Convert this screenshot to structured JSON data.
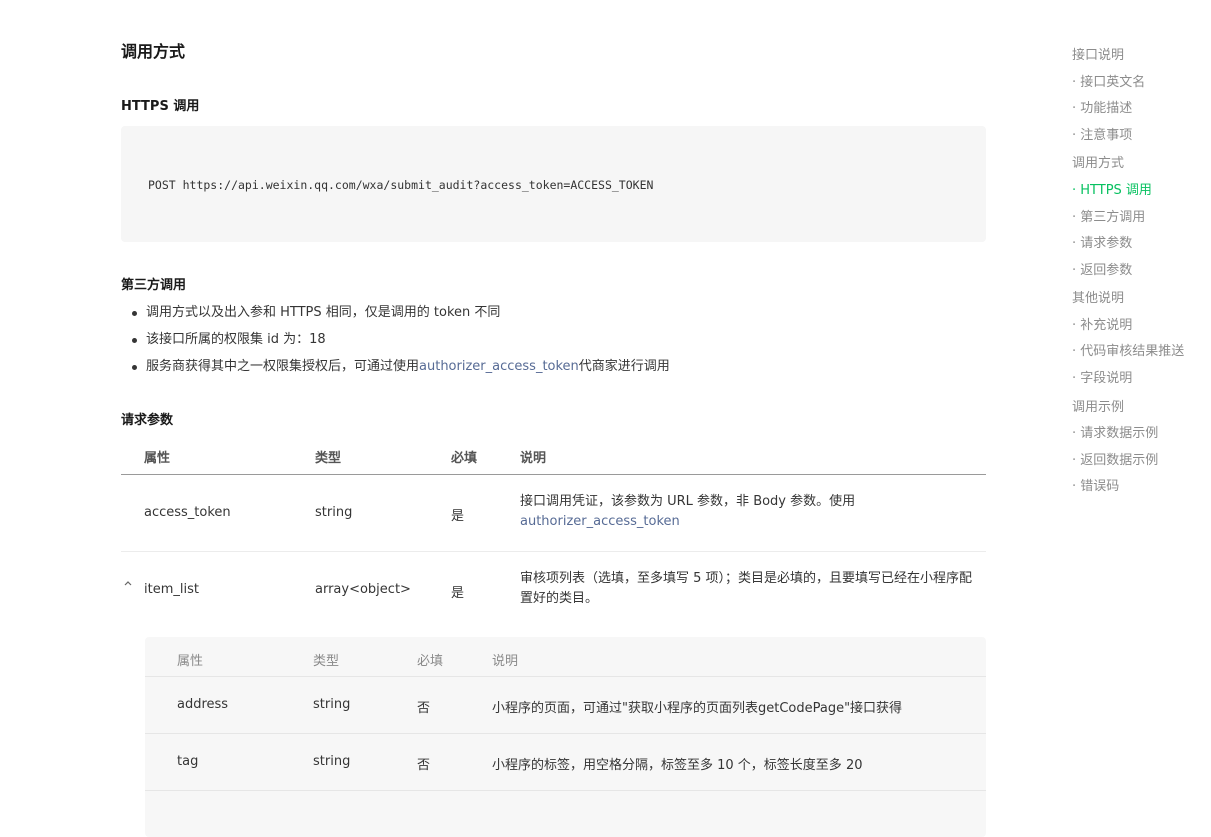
{
  "sections": {
    "call_method": "调用方式",
    "https_call": "HTTPS 调用",
    "code_line": "POST https://api.weixin.qq.com/wxa/submit_audit?access_token=ACCESS_TOKEN",
    "third_party": "第三方调用",
    "bullets": [
      "调用方式以及出入参和 HTTPS 相同，仅是调用的 token 不同",
      "该接口所属的权限集 id 为：18"
    ],
    "bullet3_prefix": "服务商获得其中之一权限集授权后，可通过使用",
    "bullet3_link": "authorizer_access_token",
    "bullet3_suffix": "代商家进行调用",
    "request_params": "请求参数"
  },
  "table": {
    "headers": [
      "属性",
      "类型",
      "必填",
      "说明"
    ],
    "rows": [
      {
        "name": "access_token",
        "type": "string",
        "required": "是",
        "desc": "接口调用凭证，该参数为 URL 参数，非 Body 参数。使用",
        "desc_link": "authorizer_access_token"
      },
      {
        "name": "item_list",
        "type": "array<object>",
        "required": "是",
        "desc": "审核项列表（选填，至多填写 5 项）；类目是必填的，且要填写已经在小程序配置好的类目。"
      }
    ]
  },
  "subtable": {
    "headers": [
      "属性",
      "类型",
      "必填",
      "说明"
    ],
    "rows": [
      {
        "name": "address",
        "type": "string",
        "required": "否",
        "desc": "小程序的页面，可通过\"获取小程序的页面列表getCodePage\"接口获得"
      },
      {
        "name": "tag",
        "type": "string",
        "required": "否",
        "desc": "小程序的标签，用空格分隔，标签至多 10 个，标签长度至多 20"
      }
    ]
  },
  "nav": {
    "items": [
      "接口说明",
      "· 接口英文名",
      "· 功能描述",
      "· 注意事项",
      "调用方式",
      "· HTTPS 调用",
      "· 第三方调用",
      "· 请求参数",
      "· 返回参数",
      "其他说明",
      "· 补充说明",
      "· 代码审核结果推送",
      "· 字段说明",
      "调用示例",
      "· 请求数据示例",
      "· 返回数据示例",
      "· 错误码"
    ],
    "active_index": 5,
    "active_color": "#07c160"
  },
  "colors": {
    "link": "#576b95",
    "code_bg": "#f6f6f6"
  }
}
